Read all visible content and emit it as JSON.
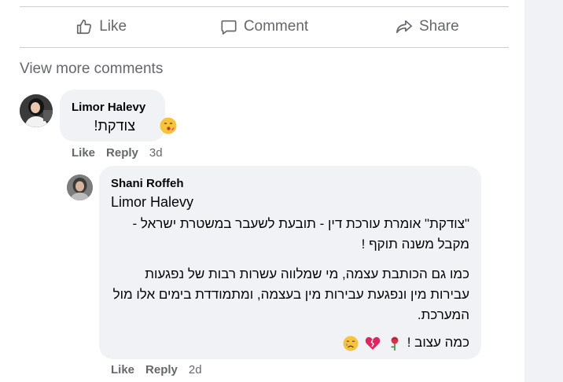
{
  "actions": {
    "like": "Like",
    "comment": "Comment",
    "share": "Share"
  },
  "view_more": "View more comments",
  "comment1": {
    "author": "Limor Halevy",
    "text": "צודקת!",
    "like": "Like",
    "reply": "Reply",
    "time": "3d"
  },
  "comment2": {
    "author": "Shani Roffeh",
    "mention": "Limor Halevy",
    "para1": "\"צודקת\" אומרת עורכת דין - תובעת לשעבר במשטרת ישראל - מקבל משנה תוקף !",
    "para2": "כמו גם הכותבת עצמה, מי שמלווה עשרות רבות של נפגעות עבירות מין ונפגעת עבירות מין בעצמה, ומתמודדת בימים אלו מול המערכת.",
    "para3": "כמה עצוב !",
    "like": "Like",
    "reply": "Reply",
    "time": "2d"
  },
  "colors": {
    "bubble": "#f0f2f5",
    "muted_text": "#65676b",
    "primary_text": "#050505",
    "divider": "#ced0d4",
    "gutter": "#f0f2f5"
  },
  "icons": {
    "like": "thumbs-up-icon",
    "comment": "speech-bubble-icon",
    "share": "share-arrow-icon",
    "emoji1": "kissing-face-icon",
    "emoji2": "rose-icon",
    "emoji3": "broken-heart-icon",
    "emoji4": "crying-face-icon"
  }
}
